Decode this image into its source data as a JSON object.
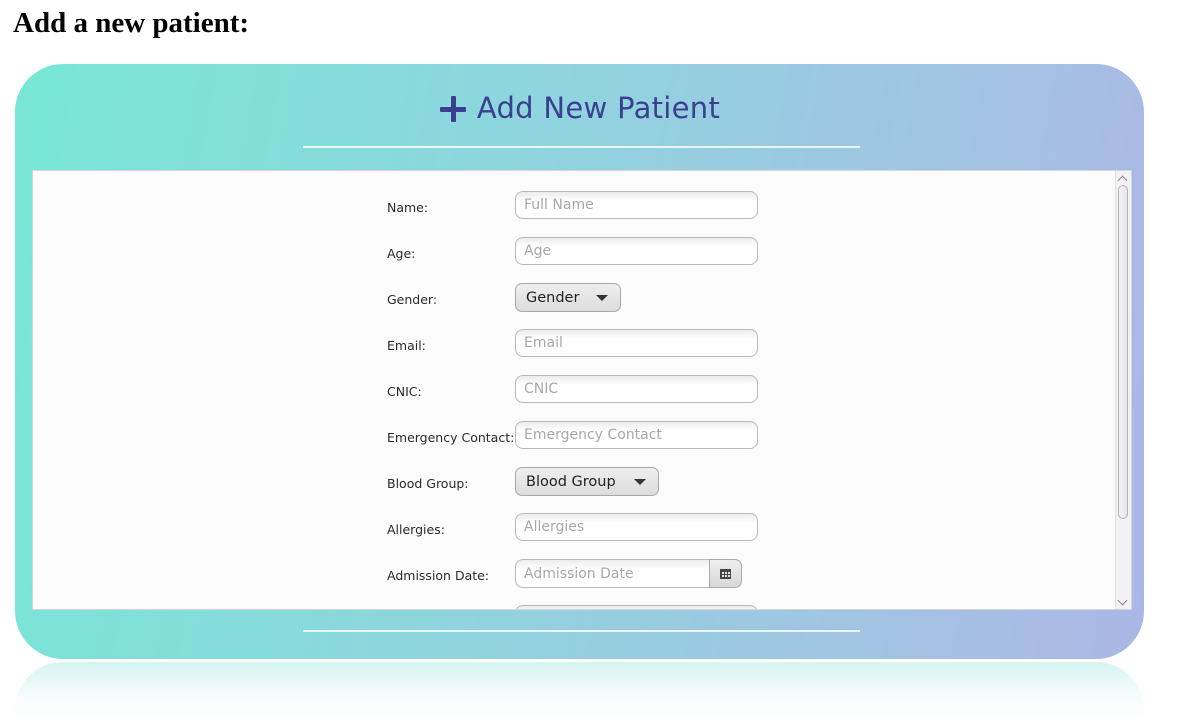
{
  "page": {
    "heading": "Add a new patient:"
  },
  "card": {
    "title": "Add New Patient"
  },
  "form": {
    "name": {
      "label": "Name:",
      "placeholder": "Full Name"
    },
    "age": {
      "label": "Age:",
      "placeholder": "Age"
    },
    "gender": {
      "label": "Gender:",
      "value": "Gender"
    },
    "email": {
      "label": "Email:",
      "placeholder": "Email"
    },
    "cnic": {
      "label": "CNIC:",
      "placeholder": "CNIC"
    },
    "emergency_contact": {
      "label": "Emergency Contact:",
      "placeholder": "Emergency Contact"
    },
    "blood_group": {
      "label": "Blood Group:",
      "value": "Blood Group"
    },
    "allergies": {
      "label": "Allergies:",
      "placeholder": "Allergies"
    },
    "admission_date": {
      "label": "Admission Date:",
      "placeholder": "Admission Date"
    }
  },
  "icons": {
    "title": "plus-icon",
    "calendar": "calendar-icon",
    "dropdown": "chevron-down-icon"
  },
  "colors": {
    "accent_title": "#3b3f8f",
    "card_gradient_start": "#78e7d6",
    "card_gradient_end": "#acb6e6"
  }
}
